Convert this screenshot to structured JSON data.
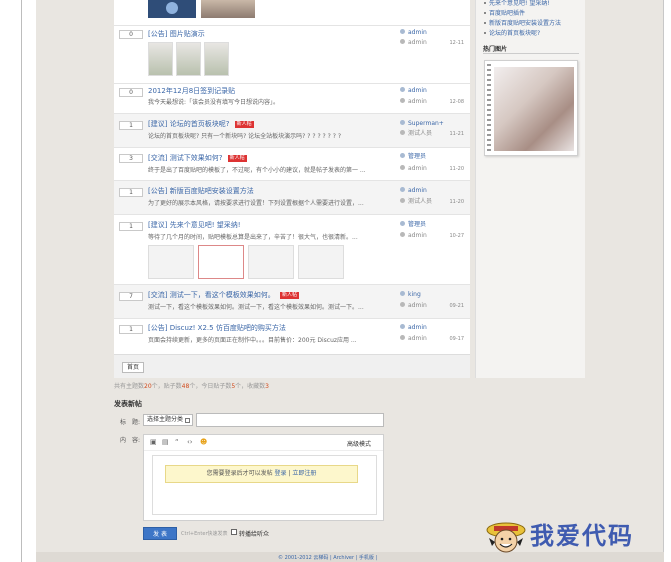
{
  "rows": [
    {
      "count": "0",
      "tag": "[公告]",
      "title": "图片贴演示",
      "hot": "",
      "summary": "",
      "author": "admin",
      "last": "admin",
      "date": "12-11"
    },
    {
      "count": "0",
      "tag": "",
      "title": "2012年12月8日签到记录贴",
      "hot": "",
      "summary": "我今天最想说:「该会员没有填写今日想说内容」。",
      "author": "admin",
      "last": "admin",
      "date": "12-08"
    },
    {
      "count": "1",
      "tag": "[建议]",
      "title": "论坛的首页板块呢?",
      "hot": "新人帖",
      "summary": "论坛的首页板块呢? 只有一个新块吗? 论坛全站板块演示吗? ? ? ? ? ? ? ?",
      "author": "Superman+",
      "last": "测试人员",
      "date": "11-21"
    },
    {
      "count": "3",
      "tag": "[交流]",
      "title": "测试下效果如何?",
      "hot": "新人帖",
      "summary": "终于是出了百度贴吧的模板了，不过呢，有个小小的建议，就是帖子发表的第一 ...",
      "author": "管理员",
      "last": "admin",
      "date": "11-20"
    },
    {
      "count": "1",
      "tag": "[公告]",
      "title": "新版百度贴吧安装设置方法",
      "hot": "",
      "summary": "为了更好的展示本风格，请按要求进行设置！下列设置根据个人需要进行设置，...",
      "author": "admin",
      "last": "测试人员",
      "date": "11-20"
    },
    {
      "count": "1",
      "tag": "[建议]",
      "title": "先来个意见吧! 望采纳!",
      "hot": "",
      "summary": "等待了几个月的时间，贴吧模板总算是出来了，辛苦了！很大气，也很清新。...",
      "author": "管理员",
      "last": "admin",
      "date": "10-27"
    },
    {
      "count": "7",
      "tag": "[交流]",
      "title": "测试一下，看这个模板效果如何。",
      "hot": "新人帖",
      "summary": "测试一下，看这个模板效果如何。测试一下，看这个模板效果如何。测试一下。...",
      "author": "king",
      "last": "admin",
      "date": "09-21"
    },
    {
      "count": "1",
      "tag": "[公告]",
      "title": "Discuz! X2.5 仿百度贴吧的购买方法",
      "hot": "",
      "summary": "页面会持续更新，更多的页面正在制作中。。。目前售价：200元 Discuz应用 ...",
      "author": "admin",
      "last": "admin",
      "date": "09-17"
    }
  ],
  "pager": {
    "first_page": "首页"
  },
  "sidebar": {
    "links": [
      "先来个意见吧! 望采纳!",
      "百度贴吧插件",
      "新版百度贴吧安装设置方法",
      "论坛的首页板块呢?"
    ],
    "heading": "热门图片"
  },
  "stats": {
    "prefix_topics": "共有主题数",
    "topics": "20",
    "prefix_posts": "个，贴子数",
    "posts": "48",
    "prefix_today": "个，今日贴子数",
    "today": "5",
    "prefix_collect": "个，收藏数",
    "collect": "3"
  },
  "form": {
    "title": "发表新帖",
    "subject_label": "标　题:",
    "select_value": "选择主题分类",
    "content_label": "内　容:",
    "advanced_mode": "高级模式",
    "login_hint": "您需要登录后才可以发帖",
    "login_link": "登录",
    "register_link": "立即注册",
    "submit": "发 表",
    "ctrl_hint": "Ctrl+Enter快速发表",
    "checkbox_label": "转播给听众"
  },
  "footer": {
    "links": "© 2001-2012 云梯码 | Archiver | 手机版 |"
  },
  "watermark": {
    "text": "我爱代码"
  },
  "colors": {
    "link": "#3a66a7",
    "hot_badge": "#d33",
    "accent_num": "#d04a1c",
    "button": "#3d76c7"
  }
}
